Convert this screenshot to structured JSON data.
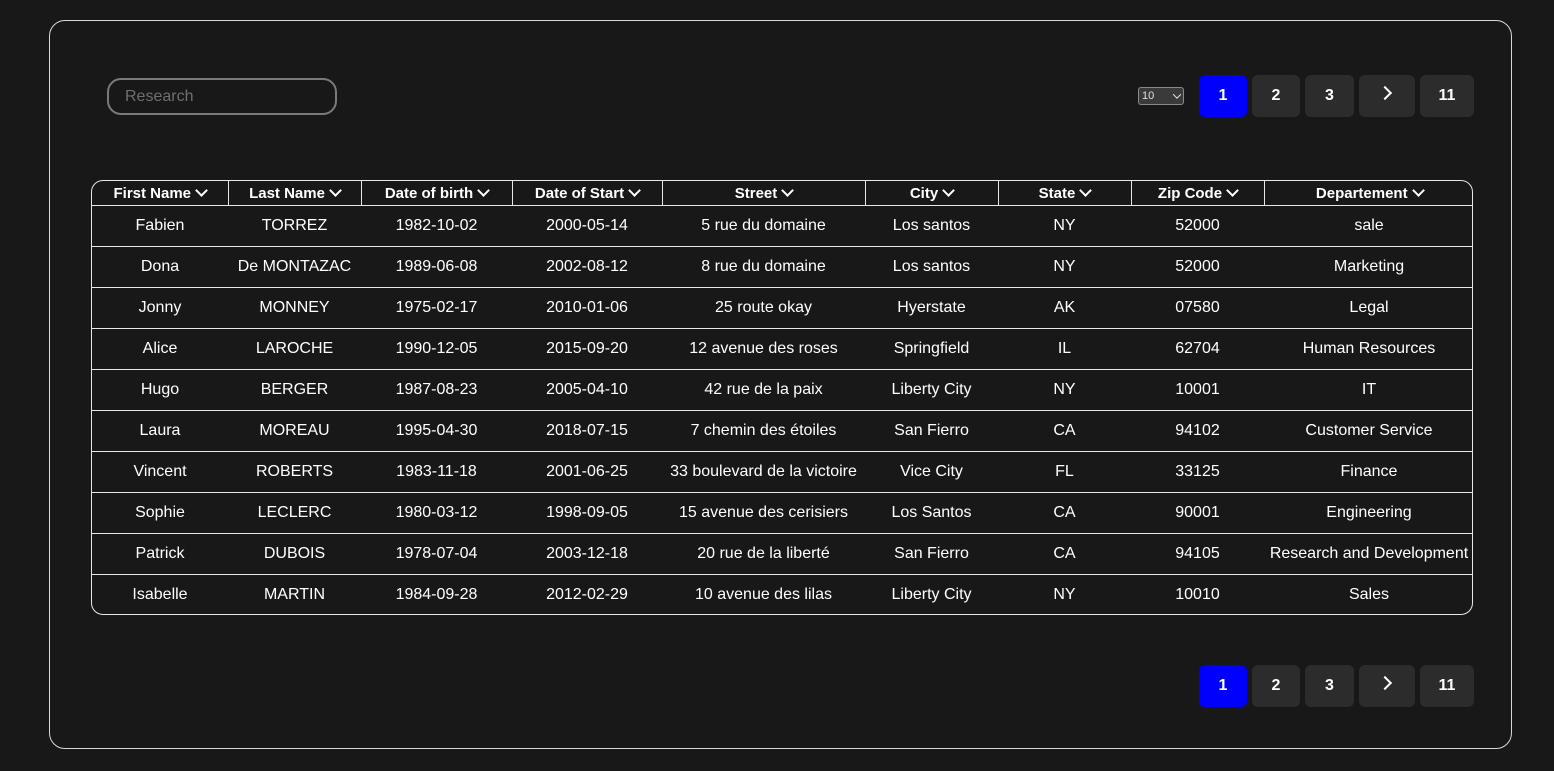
{
  "search": {
    "placeholder": "Research"
  },
  "page_size": {
    "selected": "10"
  },
  "pagination": {
    "pages": [
      "1",
      "2",
      "3"
    ],
    "last": "11",
    "active": "1"
  },
  "table": {
    "columns": [
      "First Name",
      "Last Name",
      "Date of birth",
      "Date of Start",
      "Street",
      "City",
      "State",
      "Zip Code",
      "Departement"
    ],
    "rows": [
      [
        "Fabien",
        "TORREZ",
        "1982-10-02",
        "2000-05-14",
        "5 rue du domaine",
        "Los santos",
        "NY",
        "52000",
        "sale"
      ],
      [
        "Dona",
        "De MONTAZAC",
        "1989-06-08",
        "2002-08-12",
        "8 rue du domaine",
        "Los santos",
        "NY",
        "52000",
        "Marketing"
      ],
      [
        "Jonny",
        "MONNEY",
        "1975-02-17",
        "2010-01-06",
        "25 route okay",
        "Hyerstate",
        "AK",
        "07580",
        "Legal"
      ],
      [
        "Alice",
        "LAROCHE",
        "1990-12-05",
        "2015-09-20",
        "12 avenue des roses",
        "Springfield",
        "IL",
        "62704",
        "Human Resources"
      ],
      [
        "Hugo",
        "BERGER",
        "1987-08-23",
        "2005-04-10",
        "42 rue de la paix",
        "Liberty City",
        "NY",
        "10001",
        "IT"
      ],
      [
        "Laura",
        "MOREAU",
        "1995-04-30",
        "2018-07-15",
        "7 chemin des étoiles",
        "San Fierro",
        "CA",
        "94102",
        "Customer Service"
      ],
      [
        "Vincent",
        "ROBERTS",
        "1983-11-18",
        "2001-06-25",
        "33 boulevard de la victoire",
        "Vice City",
        "FL",
        "33125",
        "Finance"
      ],
      [
        "Sophie",
        "LECLERC",
        "1980-03-12",
        "1998-09-05",
        "15 avenue des cerisiers",
        "Los Santos",
        "CA",
        "90001",
        "Engineering"
      ],
      [
        "Patrick",
        "DUBOIS",
        "1978-07-04",
        "2003-12-18",
        "20 rue de la liberté",
        "San Fierro",
        "CA",
        "94105",
        "Research and Development"
      ],
      [
        "Isabelle",
        "MARTIN",
        "1984-09-28",
        "2012-02-29",
        "10 avenue des lilas",
        "Liberty City",
        "NY",
        "10010",
        "Sales"
      ]
    ]
  },
  "colors": {
    "background": "#181818",
    "active_page": "#0000ff",
    "page_button": "#2c2c2c",
    "border": "#e8e8e8"
  }
}
